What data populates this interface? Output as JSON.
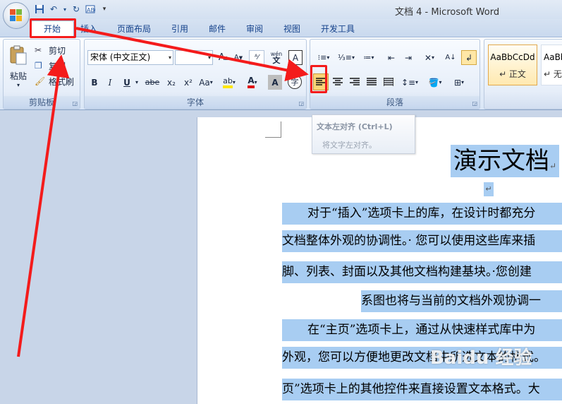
{
  "window": {
    "title": "文档 4 - Microsoft Word"
  },
  "qat": {
    "save_icon": "save-icon",
    "undo_icon": "undo-icon",
    "redo_icon": "redo-icon",
    "format_icon": "format-painter-icon",
    "customize": "▾"
  },
  "tabs": [
    "开始",
    "插入",
    "页面布局",
    "引用",
    "邮件",
    "审阅",
    "视图",
    "开发工具"
  ],
  "clipboard": {
    "label": "剪贴板",
    "paste": "粘贴",
    "cut": "剪切",
    "copy": "复制",
    "format_painter": "格式刷"
  },
  "font": {
    "label": "字体",
    "name": "宋体 (中文正文)",
    "size": "",
    "grow": "A",
    "shrink": "A",
    "wen": "wén",
    "bold": "B",
    "italic": "I",
    "underline": "U",
    "strike": "abe",
    "subscript": "x₂",
    "superscript": "x²",
    "case": "Aa",
    "highlight": "ab",
    "color": "A",
    "shade": "A",
    "enclose": "字"
  },
  "paragraph": {
    "label": "段落"
  },
  "styles": {
    "normal_sample": "AaBbCcDd",
    "normal_label": "↵ 正文",
    "nospace_sample": "AaBb",
    "nospace_label": "↵ 无"
  },
  "tooltip": {
    "title": "文本左对齐 (Ctrl+L)",
    "desc": "将文字左对齐。"
  },
  "document": {
    "title": "演示文档",
    "title_mark": "↵",
    "empty_mark": "↵",
    "lines": [
      "对于“插入”选项卡上的库，在设计时都充分",
      "文档整体外观的协调性。· 您可以使用这些库来插",
      "脚、列表、封面以及其他文档构建基块。·您创建",
      "系图也将与当前的文档外观协调一",
      "在“主页”选项卡上，通过从快速样式库中为",
      "外观，您可以方便地更改文档中所选文本的格式。",
      "页”选项卡上的其他控件来直接设置文本格式。大"
    ]
  },
  "watermark": "Baidu 经验",
  "colors": {
    "annotation": "#f41b1b",
    "selection": "#a8cdf2"
  }
}
